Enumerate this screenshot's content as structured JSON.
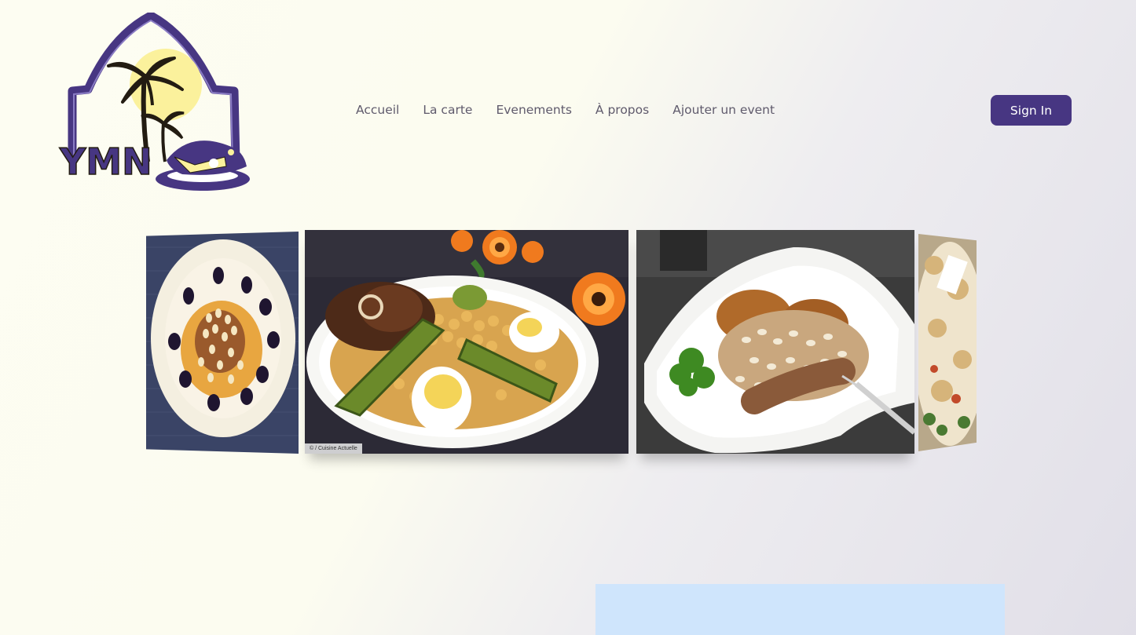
{
  "logo": {
    "text": "YMN"
  },
  "nav": {
    "items": [
      {
        "label": "Accueil"
      },
      {
        "label": "La carte"
      },
      {
        "label": "Evenements"
      },
      {
        "label": "À propos"
      },
      {
        "label": "Ajouter un event"
      }
    ]
  },
  "auth": {
    "signin_label": "Sign In"
  },
  "carousel": {
    "slides": [
      {
        "alt": "tajine-plate"
      },
      {
        "alt": "couscous-plate",
        "credit": "© / Cuisine Actuelle"
      },
      {
        "alt": "cassoulet-plate"
      },
      {
        "alt": "platter-partial"
      }
    ]
  },
  "colors": {
    "accent": "#473682",
    "panel": "#cfe5fc",
    "sun": "#fbf19c"
  }
}
